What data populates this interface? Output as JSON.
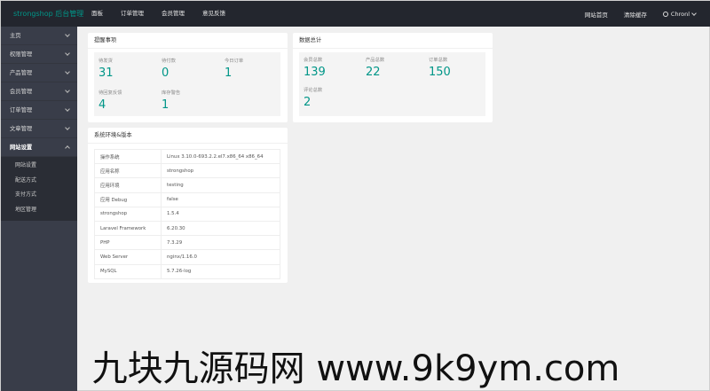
{
  "header": {
    "logo": "strongshop 后台管理",
    "nav": [
      "面板",
      "订单管理",
      "会员管理",
      "意见反馈"
    ],
    "right": {
      "site_home": "网站首页",
      "clear_cache": "清除缓存",
      "user": "Chronl"
    }
  },
  "sidebar": {
    "items": [
      {
        "label": "主页"
      },
      {
        "label": "权限管理"
      },
      {
        "label": "产品管理"
      },
      {
        "label": "会员管理"
      },
      {
        "label": "订单管理"
      },
      {
        "label": "文章管理"
      },
      {
        "label": "网站设置"
      }
    ],
    "submenu": [
      "网站设置",
      "配送方式",
      "支付方式",
      "地区管理"
    ]
  },
  "reminders": {
    "title": "提醒事项",
    "stats": [
      {
        "label": "待发货",
        "value": "31"
      },
      {
        "label": "待付款",
        "value": "0"
      },
      {
        "label": "今日订单",
        "value": "1"
      },
      {
        "label": "待回复反馈",
        "value": "4"
      },
      {
        "label": "库存警告",
        "value": "1"
      }
    ]
  },
  "totals": {
    "title": "数据总计",
    "stats": [
      {
        "label": "会员总数",
        "value": "139"
      },
      {
        "label": "产品总数",
        "value": "22"
      },
      {
        "label": "订单总数",
        "value": "150"
      },
      {
        "label": "评论总数",
        "value": "2"
      }
    ]
  },
  "env": {
    "title": "系统环境&版本",
    "rows": [
      {
        "key": "操作系统",
        "value": "Linux 3.10.0-693.2.2.el7.x86_64 x86_64"
      },
      {
        "key": "应用名称",
        "value": "strongshop"
      },
      {
        "key": "应用环境",
        "value": "testing"
      },
      {
        "key": "应用 Debug",
        "value": "false"
      },
      {
        "key": "strongshop",
        "value": "1.5.4"
      },
      {
        "key": "Laravel Framework",
        "value": "6.20.30"
      },
      {
        "key": "PHP",
        "value": "7.3.29"
      },
      {
        "key": "Web Server",
        "value": "nginx/1.16.0"
      },
      {
        "key": "MySQL",
        "value": "5.7.26-log"
      }
    ]
  },
  "watermark": "九块九源码网 www.9k9ym.com",
  "colors": {
    "accent": "#009688",
    "header_bg": "#23262e",
    "sidebar_bg": "#393d49"
  }
}
